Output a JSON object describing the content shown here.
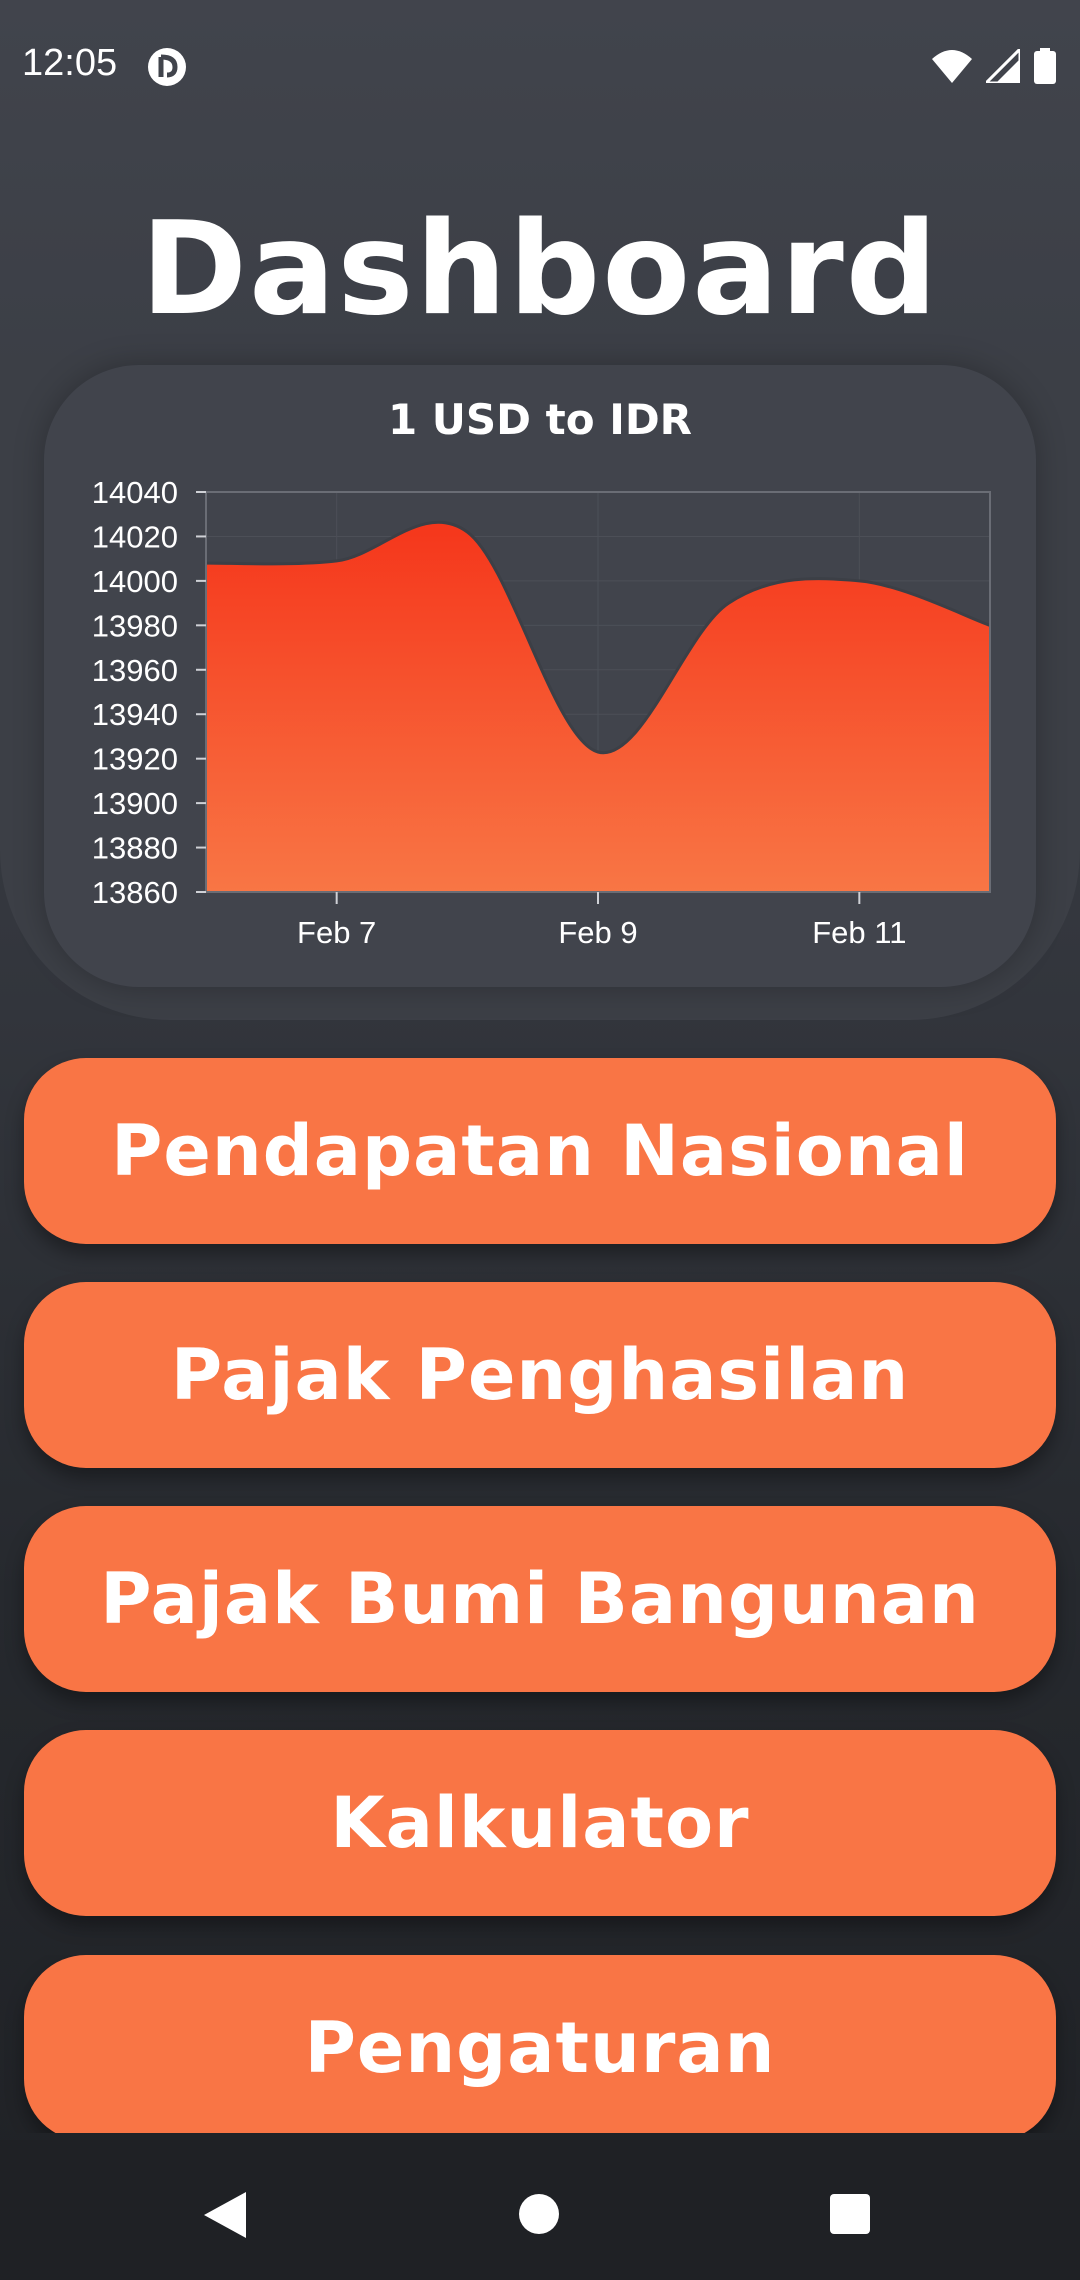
{
  "status_bar": {
    "time": "12:05",
    "icons": [
      "app-notification-icon",
      "wifi-icon",
      "cellular-signal-icon",
      "battery-icon"
    ]
  },
  "page": {
    "title": "Dashboard"
  },
  "chart_data": {
    "type": "area",
    "title": "1 USD to IDR",
    "xlabel": "",
    "ylabel": "",
    "x_tick_labels": [
      "Feb 7",
      "Feb 9",
      "Feb 11"
    ],
    "y_tick_labels": [
      "14040",
      "14020",
      "14000",
      "13980",
      "13960",
      "13940",
      "13920",
      "13900",
      "13880",
      "13860"
    ],
    "x": [
      "Feb 6",
      "Feb 7",
      "Feb 8",
      "Feb 9",
      "Feb 10",
      "Feb 11",
      "Feb 12"
    ],
    "series": [
      {
        "values": [
          14008,
          14009,
          14022,
          13923,
          13990,
          14000,
          13980
        ]
      }
    ],
    "ylim": [
      13860,
      14040
    ],
    "grid": true,
    "fill_gradient": [
      "#f5361b",
      "#f87645"
    ],
    "line_color": "#3c3f46"
  },
  "menu": {
    "buttons": [
      {
        "label": "Pendapatan Nasional"
      },
      {
        "label": "Pajak Penghasilan"
      },
      {
        "label": "Pajak Bumi Bangunan"
      },
      {
        "label": "Kalkulator"
      },
      {
        "label": "Pengaturan"
      }
    ],
    "accent": "#f97545"
  },
  "nav_bar": {
    "icons": [
      "back-icon",
      "home-icon",
      "recents-icon"
    ]
  }
}
